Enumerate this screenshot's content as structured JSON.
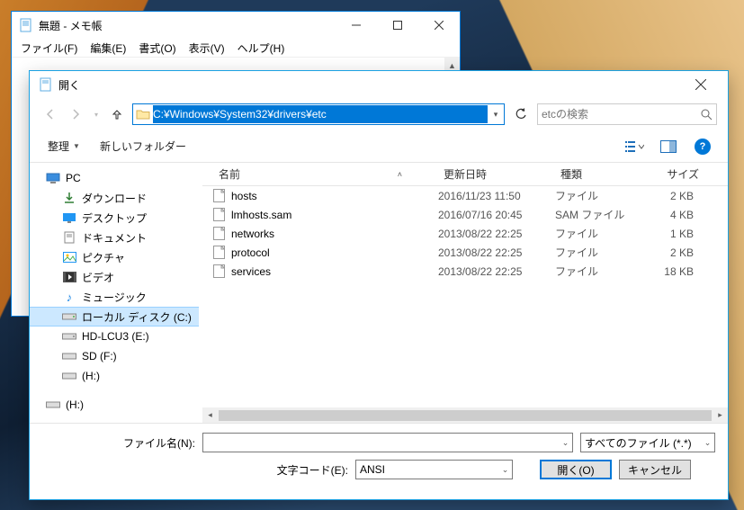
{
  "notepad": {
    "title": "無題 - メモ帳",
    "menu": {
      "file": "ファイル(F)",
      "edit": "編集(E)",
      "format": "書式(O)",
      "view": "表示(V)",
      "help": "ヘルプ(H)"
    }
  },
  "dialog": {
    "title": "開く",
    "address": "C:¥Windows¥System32¥drivers¥etc",
    "search_placeholder": "etcの検索",
    "toolbar": {
      "organize": "整理",
      "newfolder": "新しいフォルダー"
    },
    "tree": {
      "pc": "PC",
      "downloads": "ダウンロード",
      "desktop": "デスクトップ",
      "documents": "ドキュメント",
      "pictures": "ピクチャ",
      "videos": "ビデオ",
      "music": "ミュージック",
      "localdisk": "ローカル ディスク (C:)",
      "hdlcu3": "HD-LCU3 (E:)",
      "sdf": "SD (F:)",
      "h": " (H:)",
      "h2": "(H:)"
    },
    "columns": {
      "name": "名前",
      "date": "更新日時",
      "type": "種類",
      "size": "サイズ"
    },
    "files": [
      {
        "name": "hosts",
        "date": "2016/11/23 11:50",
        "type": "ファイル",
        "size": "2 KB"
      },
      {
        "name": "lmhosts.sam",
        "date": "2016/07/16 20:45",
        "type": "SAM ファイル",
        "size": "4 KB"
      },
      {
        "name": "networks",
        "date": "2013/08/22 22:25",
        "type": "ファイル",
        "size": "1 KB"
      },
      {
        "name": "protocol",
        "date": "2013/08/22 22:25",
        "type": "ファイル",
        "size": "2 KB"
      },
      {
        "name": "services",
        "date": "2013/08/22 22:25",
        "type": "ファイル",
        "size": "18 KB"
      }
    ],
    "filename_label": "ファイル名(N):",
    "filter": "すべてのファイル (*.*)",
    "encoding_label": "文字コード(E):",
    "encoding": "ANSI",
    "open_btn": "開く(O)",
    "cancel_btn": "キャンセル"
  }
}
